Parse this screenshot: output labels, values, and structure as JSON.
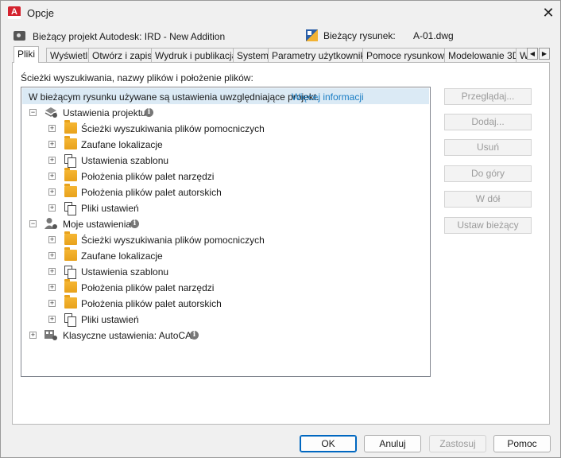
{
  "window": {
    "title": "Opcje",
    "close_glyph": "✕",
    "app_icon_letter": "A"
  },
  "header": {
    "project_label": "Bieżący projekt Autodesk: IRD - New Addition",
    "drawing_label": "Bieżący rysunek:",
    "drawing_value": "A-01.dwg"
  },
  "tabs": [
    {
      "label": "Pliki",
      "active": true
    },
    {
      "label": "Wyświetl",
      "active": false
    },
    {
      "label": "Otwórz i zapisz",
      "active": false
    },
    {
      "label": "Wydruk i publikacja",
      "active": false
    },
    {
      "label": "System",
      "active": false
    },
    {
      "label": "Parametry użytkownika",
      "active": false
    },
    {
      "label": "Pomoce rysunkowe",
      "active": false
    },
    {
      "label": "Modelowanie 3D",
      "active": false
    },
    {
      "label": "W",
      "active": false
    }
  ],
  "tab_scroll": {
    "left": "◀",
    "right": "▶"
  },
  "files": {
    "section_label": "Ścieżki wyszukiwania, nazwy plików i położenie plików:",
    "info_text": "W bieżącym rysunku używane są ustawienia uwzględniające projekt.",
    "info_link": "Więcej informacji",
    "groups": [
      {
        "label": "Ustawienia projektu",
        "expander": "−",
        "icon": "project-settings-icon",
        "items": [
          {
            "label": "Ścieżki wyszukiwania plików pomocniczych",
            "icon": "folder-icon"
          },
          {
            "label": "Zaufane lokalizacje",
            "icon": "folder-icon"
          },
          {
            "label": "Ustawienia szablonu",
            "icon": "copy-icon"
          },
          {
            "label": "Położenia plików palet narzędzi",
            "icon": "folder-icon"
          },
          {
            "label": "Położenia plików palet autorskich",
            "icon": "folder-icon"
          },
          {
            "label": "Pliki ustawień",
            "icon": "copy-icon"
          }
        ]
      },
      {
        "label": "Moje ustawienia",
        "expander": "−",
        "icon": "user-settings-icon",
        "items": [
          {
            "label": "Ścieżki wyszukiwania plików pomocniczych",
            "icon": "folder-icon"
          },
          {
            "label": "Zaufane lokalizacje",
            "icon": "folder-icon"
          },
          {
            "label": "Ustawienia szablonu",
            "icon": "copy-icon"
          },
          {
            "label": "Położenia plików palet narzędzi",
            "icon": "folder-icon"
          },
          {
            "label": "Położenia plików palet autorskich",
            "icon": "folder-icon"
          },
          {
            "label": "Pliki ustawień",
            "icon": "copy-icon"
          }
        ]
      },
      {
        "label": "Klasyczne ustawienia: AutoCAD",
        "expander": "+",
        "icon": "classic-settings-icon",
        "items": []
      }
    ],
    "item_expander": "+"
  },
  "side_buttons": {
    "browse": "Przeglądaj...",
    "add": "Dodaj...",
    "remove": "Usuń",
    "move_up": "Do góry",
    "move_down": "W dół",
    "set_current": "Ustaw bieżący"
  },
  "footer": {
    "ok": "OK",
    "cancel": "Anuluj",
    "apply": "Zastosuj",
    "help": "Pomoc"
  },
  "colors": {
    "accent": "#0067c0",
    "info_strip": "#dbeaf5",
    "link": "#1a7dc4",
    "app_icon": "#d4232f",
    "folder": "#f0ad2a"
  }
}
